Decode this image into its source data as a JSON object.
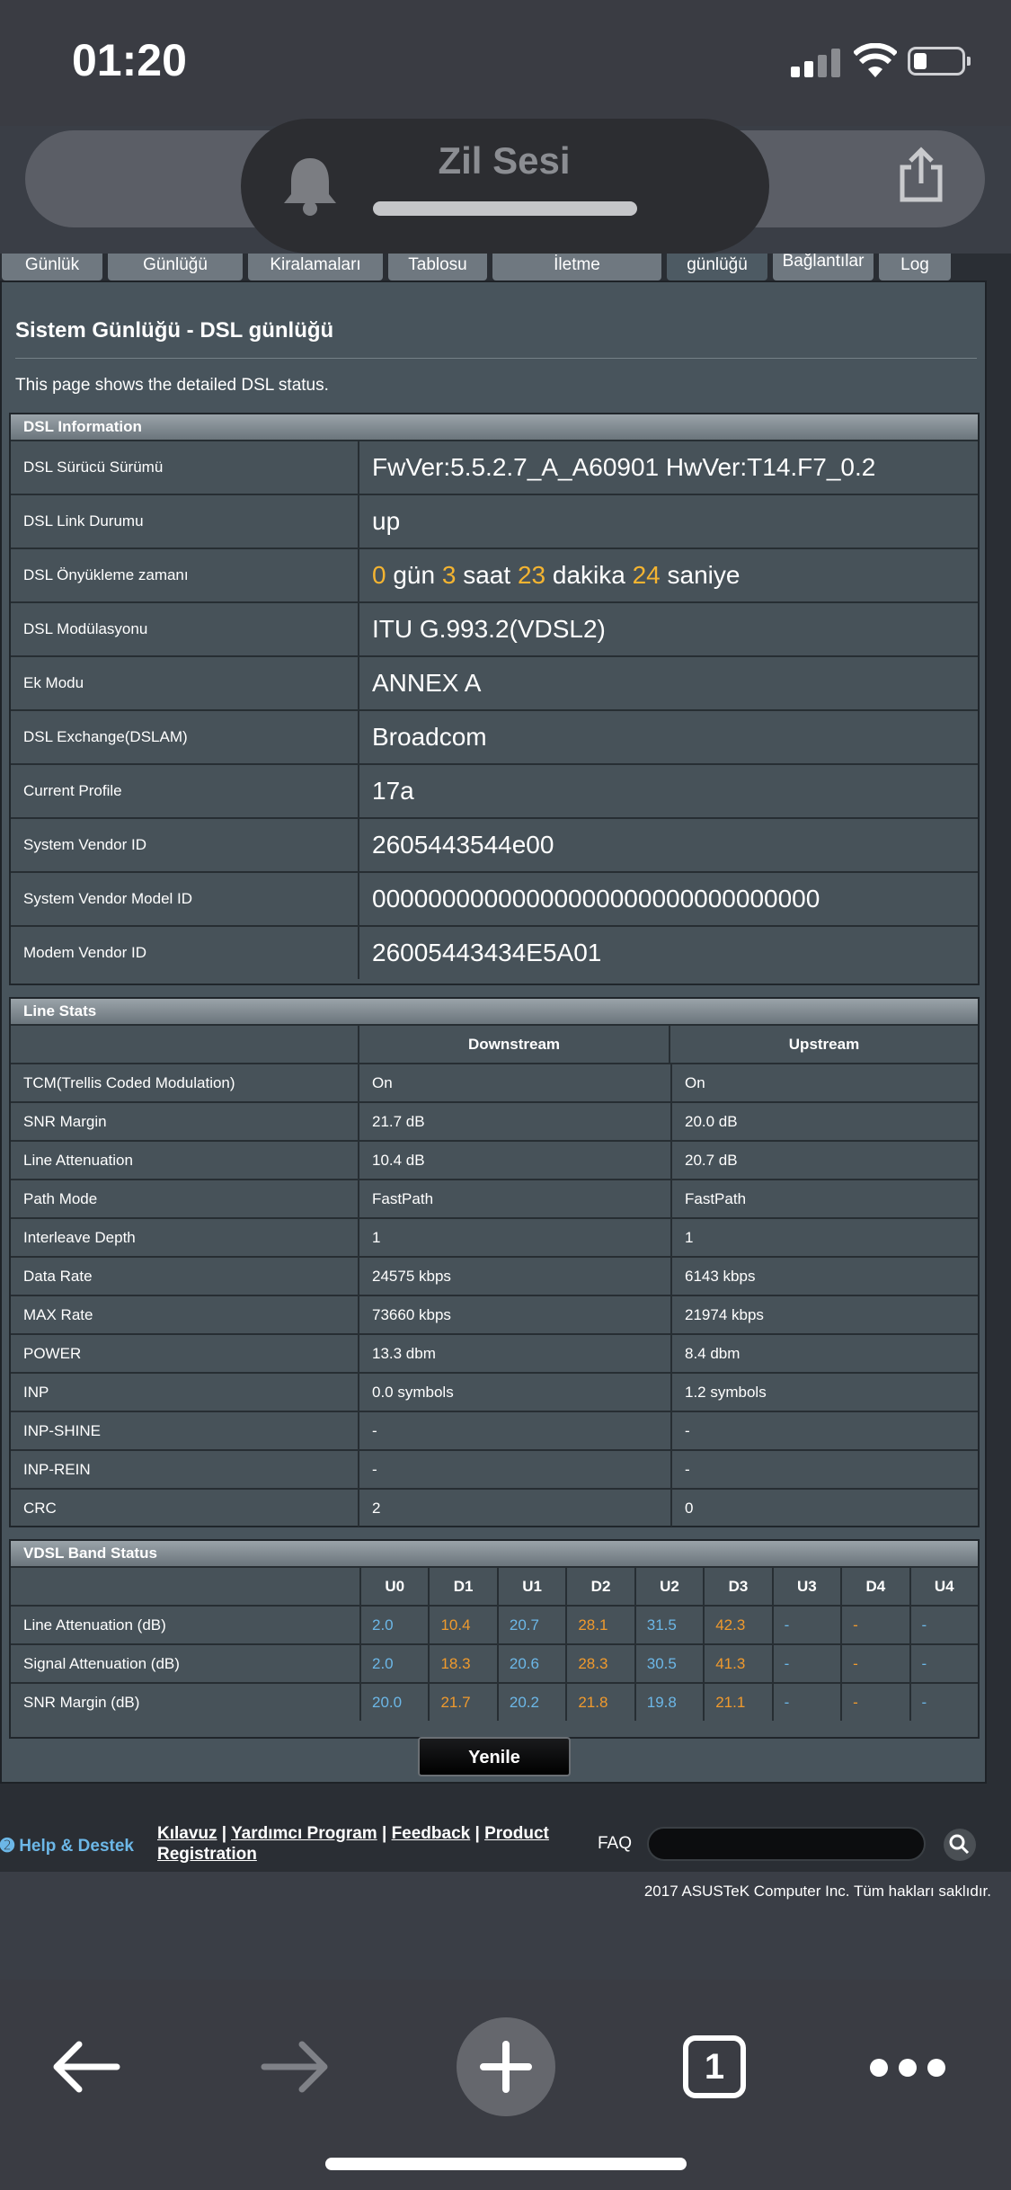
{
  "status_bar": {
    "time": "01:20"
  },
  "ringer_banner": {
    "title": "Zil Sesi"
  },
  "tabs": [
    {
      "label": "Günlük"
    },
    {
      "label": "Günlüğü"
    },
    {
      "label": "Kiralamaları"
    },
    {
      "label": "Tablosu"
    },
    {
      "label": "İletme"
    },
    {
      "label": "günlüğü"
    },
    {
      "label": "Bağlantılar"
    },
    {
      "label": "Log"
    }
  ],
  "page": {
    "title": "Sistem Günlüğü - DSL günlüğü",
    "description": "This page shows the detailed DSL status."
  },
  "dsl_info": {
    "header": "DSL Information",
    "rows": [
      {
        "label": "DSL Sürücü Sürümü",
        "value": "FwVer:5.5.2.7_A_A60901 HwVer:T14.F7_0.2"
      },
      {
        "label": "DSL Link Durumu",
        "value": "up"
      },
      {
        "label": "DSL Önyükleme zamanı",
        "uptime": {
          "d": "0",
          "d_unit": "gün",
          "h": "3",
          "h_unit": "saat",
          "m": "23",
          "m_unit": "dakika",
          "s": "24",
          "s_unit": "saniye"
        }
      },
      {
        "label": "DSL Modülasyonu",
        "value": "ITU G.993.2(VDSL2)"
      },
      {
        "label": "Ek Modu",
        "value": "ANNEX A"
      },
      {
        "label": "DSL Exchange(DSLAM)",
        "value": "Broadcom"
      },
      {
        "label": "Current Profile",
        "value": "17a"
      },
      {
        "label": "System Vendor ID",
        "value": "2605443544e00"
      },
      {
        "label": "System Vendor Model ID",
        "value": "00000000000000000000000000000000"
      },
      {
        "label": "Modem Vendor ID",
        "value": "26005443434E5A01"
      }
    ]
  },
  "line_stats": {
    "header": "Line Stats",
    "col_down": "Downstream",
    "col_up": "Upstream",
    "rows": [
      {
        "label": "TCM(Trellis Coded Modulation)",
        "down": "On",
        "up": "On"
      },
      {
        "label": "SNR Margin",
        "down": "21.7 dB",
        "up": "20.0 dB"
      },
      {
        "label": "Line Attenuation",
        "down": "10.4 dB",
        "up": "20.7 dB"
      },
      {
        "label": "Path Mode",
        "down": "FastPath",
        "up": "FastPath"
      },
      {
        "label": "Interleave Depth",
        "down": "1",
        "up": "1"
      },
      {
        "label": "Data Rate",
        "down": "24575 kbps",
        "up": "6143 kbps"
      },
      {
        "label": "MAX Rate",
        "down": "73660 kbps",
        "up": "21974 kbps"
      },
      {
        "label": "POWER",
        "down": "13.3 dbm",
        "up": "8.4 dbm"
      },
      {
        "label": "INP",
        "down": "0.0 symbols",
        "up": "1.2 symbols"
      },
      {
        "label": "INP-SHINE",
        "down": "-",
        "up": "-"
      },
      {
        "label": "INP-REIN",
        "down": "-",
        "up": "-"
      },
      {
        "label": "CRC",
        "down": "2",
        "up": "0"
      }
    ]
  },
  "vdsl_band": {
    "header": "VDSL Band Status",
    "bands": [
      "U0",
      "D1",
      "U1",
      "D2",
      "U2",
      "D3",
      "U3",
      "D4",
      "U4"
    ],
    "rows": [
      {
        "label": "Line Attenuation (dB)",
        "values": [
          "2.0",
          "10.4",
          "20.7",
          "28.1",
          "31.5",
          "42.3",
          "-",
          "-",
          "-"
        ]
      },
      {
        "label": "Signal Attenuation (dB)",
        "values": [
          "2.0",
          "18.3",
          "20.6",
          "28.3",
          "30.5",
          "41.3",
          "-",
          "-",
          "-"
        ]
      },
      {
        "label": "SNR Margin (dB)",
        "values": [
          "20.0",
          "21.7",
          "20.2",
          "21.8",
          "19.8",
          "21.1",
          "-",
          "-",
          "-"
        ]
      }
    ],
    "colors": {
      "upstream": "#6cb7e7",
      "downstream": "#f09a2d"
    }
  },
  "refresh_button": "Yenile",
  "footer": {
    "help": "Help & Destek",
    "links": [
      "Kılavuz",
      "Yardımcı Program",
      "Feedback",
      "Product Registration"
    ],
    "faq": "FAQ",
    "copyright": "2017 ASUSTeK Computer Inc. Tüm hakları saklıdır."
  },
  "toolbar": {
    "tab_count": "1"
  },
  "accent": {
    "highlight": "#f4b431"
  }
}
